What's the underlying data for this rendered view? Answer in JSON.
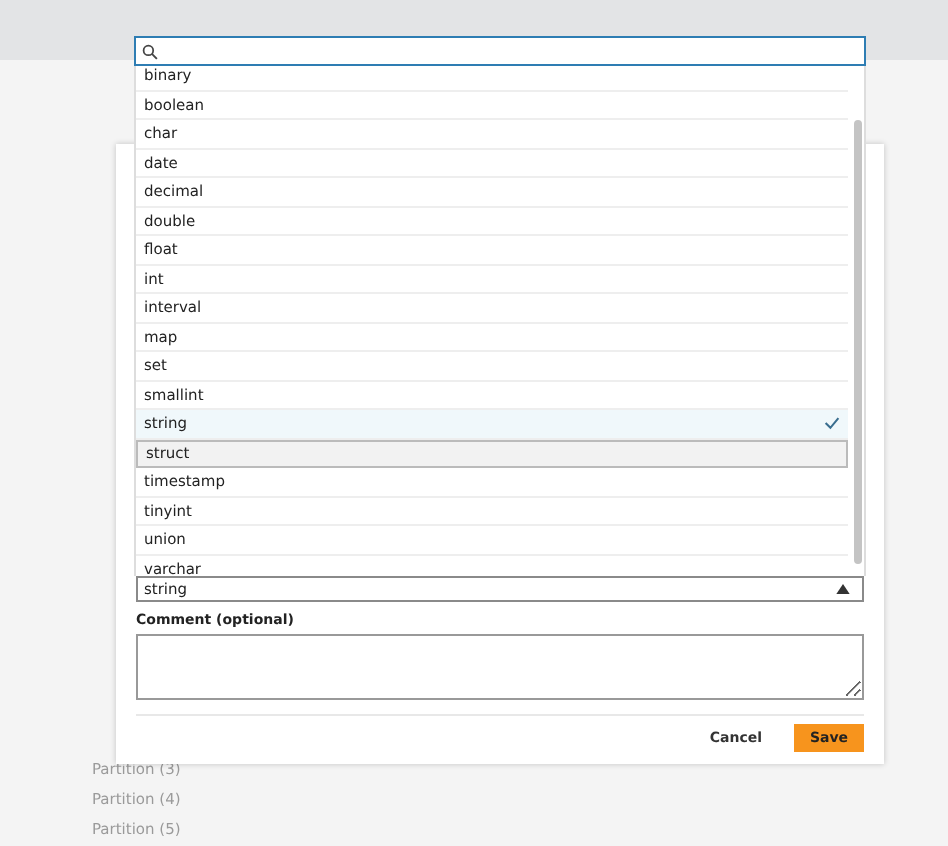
{
  "background": {
    "partitions": [
      "Partition (3)",
      "Partition (4)",
      "Partition (5)"
    ]
  },
  "type_select": {
    "value": "string",
    "open": true
  },
  "options": [
    {
      "label": "binary",
      "selected": false,
      "highlighted": false
    },
    {
      "label": "boolean",
      "selected": false,
      "highlighted": false
    },
    {
      "label": "char",
      "selected": false,
      "highlighted": false
    },
    {
      "label": "date",
      "selected": false,
      "highlighted": false
    },
    {
      "label": "decimal",
      "selected": false,
      "highlighted": false
    },
    {
      "label": "double",
      "selected": false,
      "highlighted": false
    },
    {
      "label": "float",
      "selected": false,
      "highlighted": false
    },
    {
      "label": "int",
      "selected": false,
      "highlighted": false
    },
    {
      "label": "interval",
      "selected": false,
      "highlighted": false
    },
    {
      "label": "map",
      "selected": false,
      "highlighted": false
    },
    {
      "label": "set",
      "selected": false,
      "highlighted": false
    },
    {
      "label": "smallint",
      "selected": false,
      "highlighted": false
    },
    {
      "label": "string",
      "selected": true,
      "highlighted": false
    },
    {
      "label": "struct",
      "selected": false,
      "highlighted": true
    },
    {
      "label": "timestamp",
      "selected": false,
      "highlighted": false
    },
    {
      "label": "tinyint",
      "selected": false,
      "highlighted": false
    },
    {
      "label": "union",
      "selected": false,
      "highlighted": false
    },
    {
      "label": "varchar",
      "selected": false,
      "highlighted": false
    }
  ],
  "comment": {
    "label": "Comment (optional)"
  },
  "buttons": {
    "cancel": "Cancel",
    "save": "Save"
  }
}
